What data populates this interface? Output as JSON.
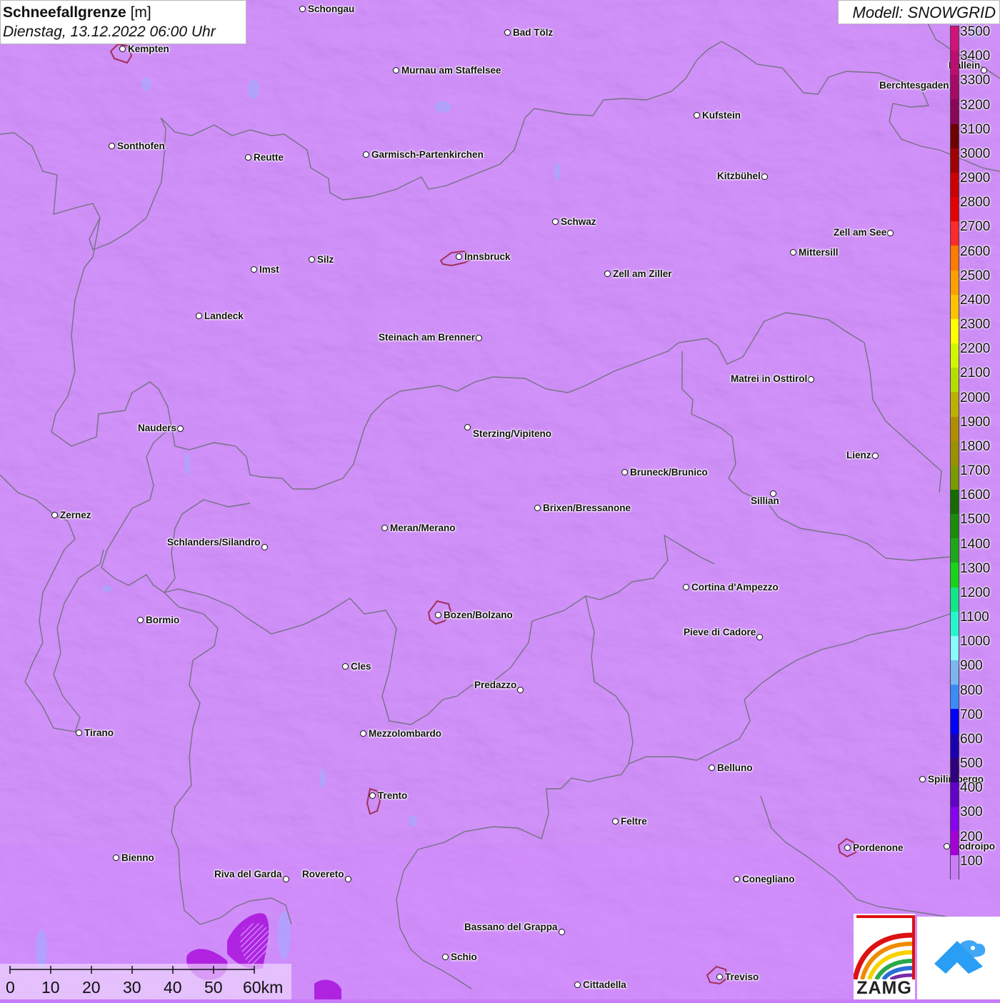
{
  "title": {
    "bold": "Schneefallgrenze",
    "unit": " [m]",
    "datetime": "Dienstag, 13.12.2022 06:00 Uhr"
  },
  "model": "Modell: SNOWGRID",
  "legend": {
    "labels": [
      "3500",
      "3400",
      "3300",
      "3200",
      "3100",
      "3000",
      "2900",
      "2800",
      "2700",
      "2600",
      "2500",
      "2400",
      "2300",
      "2200",
      "2100",
      "2000",
      "1900",
      "1800",
      "1700",
      "1600",
      "1500",
      "1400",
      "1300",
      "1200",
      "1100",
      "1000",
      "900",
      "800",
      "700",
      "600",
      "500",
      "400",
      "300",
      "200",
      "100"
    ],
    "colors": [
      "#d1137a",
      "#be0d71",
      "#a50a66",
      "#8c0658",
      "#6e0000",
      "#a00000",
      "#cc0000",
      "#e60000",
      "#ff2a2a",
      "#ff7a00",
      "#ff9f00",
      "#ffc200",
      "#ffff00",
      "#d2f500",
      "#b6dc00",
      "#bcb000",
      "#b08e00",
      "#9b9000",
      "#7a9a00",
      "#166c00",
      "#1a8c0a",
      "#1ea71a",
      "#18d418",
      "#10e888",
      "#28f5cc",
      "#88fcfc",
      "#7cb6f0",
      "#3a8cf8",
      "#0000ff",
      "#1a00b0",
      "#300080",
      "#6000c8",
      "#8a00f0",
      "#a400d8",
      "#c97cfa"
    ]
  },
  "cities": [
    {
      "name": "Schongau",
      "dot": [
        424,
        13
      ],
      "side": "right"
    },
    {
      "name": "Bad Tölz",
      "dot": [
        711,
        46
      ],
      "side": "right"
    },
    {
      "name": "Kempten",
      "dot": [
        172,
        69
      ],
      "side": "right"
    },
    {
      "name": "Murnau am Staffelsee",
      "dot": [
        555,
        99
      ],
      "side": "right"
    },
    {
      "name": "Berchtesgaden",
      "dot": [
        1335,
        121
      ],
      "side": "left"
    },
    {
      "name": "Kufstein",
      "dot": [
        976,
        162
      ],
      "side": "right"
    },
    {
      "name": "Sonthofen",
      "dot": [
        157,
        205
      ],
      "side": "right"
    },
    {
      "name": "Reutte",
      "dot": [
        348,
        221
      ],
      "side": "right"
    },
    {
      "name": "Garmisch-Partenkirchen",
      "dot": [
        513,
        217
      ],
      "side": "right"
    },
    {
      "name": "Kitzbühel",
      "dot": [
        1071,
        248
      ],
      "side": "left"
    },
    {
      "name": "Schwaz",
      "dot": [
        778,
        311
      ],
      "side": "right"
    },
    {
      "name": "Zell am See",
      "dot": [
        1247,
        327
      ],
      "side": "left"
    },
    {
      "name": "Mittersill",
      "dot": [
        1111,
        354
      ],
      "side": "right"
    },
    {
      "name": "Innsbruck",
      "dot": [
        643,
        360
      ],
      "side": "right"
    },
    {
      "name": "Silz",
      "dot": [
        437,
        364
      ],
      "side": "right"
    },
    {
      "name": "Imst",
      "dot": [
        356,
        378
      ],
      "side": "right"
    },
    {
      "name": "Zell am Ziller",
      "dot": [
        851,
        384
      ],
      "side": "right"
    },
    {
      "name": "Landeck",
      "dot": [
        279,
        443
      ],
      "side": "right"
    },
    {
      "name": "Steinach am Brenner",
      "dot": [
        671,
        474
      ],
      "side": "left"
    },
    {
      "name": "Matrei in Osttirol",
      "dot": [
        1136,
        532
      ],
      "side": "left"
    },
    {
      "name": "Nauders",
      "dot": [
        253,
        601
      ],
      "side": "left"
    },
    {
      "name": "Sterzing/Vipiteno",
      "dot": [
        655,
        599
      ],
      "side": "belowright"
    },
    {
      "name": "Lienz",
      "dot": [
        1226,
        639
      ],
      "side": "left"
    },
    {
      "name": "Bruneck/Brunico",
      "dot": [
        875,
        662
      ],
      "side": "right"
    },
    {
      "name": "Sillian",
      "dot": [
        1083,
        692
      ],
      "side": "below-left"
    },
    {
      "name": "Brixen/Bressanone",
      "dot": [
        753,
        712
      ],
      "side": "right"
    },
    {
      "name": "Zernez",
      "dot": [
        77,
        722
      ],
      "side": "right"
    },
    {
      "name": "Meran/Merano",
      "dot": [
        539,
        740
      ],
      "side": "right"
    },
    {
      "name": "Schlanders/Silandro",
      "dot": [
        371,
        767
      ],
      "side": "left-up"
    },
    {
      "name": "Cortina d'Ampezzo",
      "dot": [
        961,
        823
      ],
      "side": "right"
    },
    {
      "name": "Bozen/Bolzano",
      "dot": [
        614,
        862
      ],
      "side": "right"
    },
    {
      "name": "Bormio",
      "dot": [
        197,
        869
      ],
      "side": "right"
    },
    {
      "name": "Pieve di Cadore",
      "dot": [
        1064,
        893
      ],
      "side": "left-up"
    },
    {
      "name": "Cles",
      "dot": [
        484,
        934
      ],
      "side": "right"
    },
    {
      "name": "Predazzo",
      "dot": [
        729,
        967
      ],
      "side": "left-up"
    },
    {
      "name": "Tirano",
      "dot": [
        111,
        1027
      ],
      "side": "right"
    },
    {
      "name": "Mezzolombardo",
      "dot": [
        509,
        1028
      ],
      "side": "right"
    },
    {
      "name": "Belluno",
      "dot": [
        997,
        1076
      ],
      "side": "right"
    },
    {
      "name": "Spilimbergo",
      "dot": [
        1292,
        1092
      ],
      "side": "right"
    },
    {
      "name": "Trento",
      "dot": [
        522,
        1115
      ],
      "side": "right"
    },
    {
      "name": "Feltre",
      "dot": [
        862,
        1151
      ],
      "side": "right"
    },
    {
      "name": "Pordenone",
      "dot": [
        1187,
        1188
      ],
      "side": "right"
    },
    {
      "name": "Codroipo",
      "dot": [
        1326,
        1186
      ],
      "side": "right"
    },
    {
      "name": "Bienno",
      "dot": [
        163,
        1202
      ],
      "side": "right"
    },
    {
      "name": "Riva del Garda",
      "dot": [
        401,
        1232
      ],
      "side": "left-up"
    },
    {
      "name": "Rovereto",
      "dot": [
        488,
        1232
      ],
      "side": "left-up"
    },
    {
      "name": "Conegliano",
      "dot": [
        1032,
        1232
      ],
      "side": "right"
    },
    {
      "name": "Bassano del Grappa",
      "dot": [
        787,
        1306
      ],
      "side": "left-up"
    },
    {
      "name": "Schio",
      "dot": [
        624,
        1341
      ],
      "side": "right"
    },
    {
      "name": "Treviso",
      "dot": [
        1008,
        1369
      ],
      "side": "right"
    },
    {
      "name": "Cittadella",
      "dot": [
        809,
        1380
      ],
      "side": "right"
    },
    {
      "name": "Hallein",
      "dot": [
        1378,
        99
      ],
      "side": "left-up"
    }
  ],
  "scale": {
    "labels": [
      "0",
      "10",
      "20",
      "30",
      "40",
      "50",
      "60km"
    ]
  },
  "logos": {
    "zamg": "ZAMG"
  }
}
